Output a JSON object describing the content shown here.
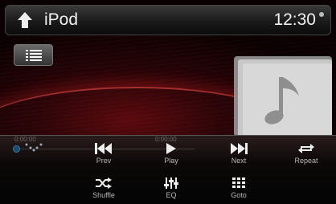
{
  "header": {
    "title": "iPod",
    "time": "12:30"
  },
  "progress": {
    "elapsed": "0:00:00",
    "total": "0:00:00",
    "position": 0
  },
  "controls": {
    "prev": "Prev",
    "play": "Play",
    "next": "Next",
    "repeat": "Repeat",
    "shuffle": "Shuffle",
    "eq": "EQ",
    "goto": "Goto"
  },
  "icons": {
    "home": "home-icon",
    "list": "list-icon",
    "album": "music-note-icon",
    "mode": "dotted-chevron-icon"
  }
}
